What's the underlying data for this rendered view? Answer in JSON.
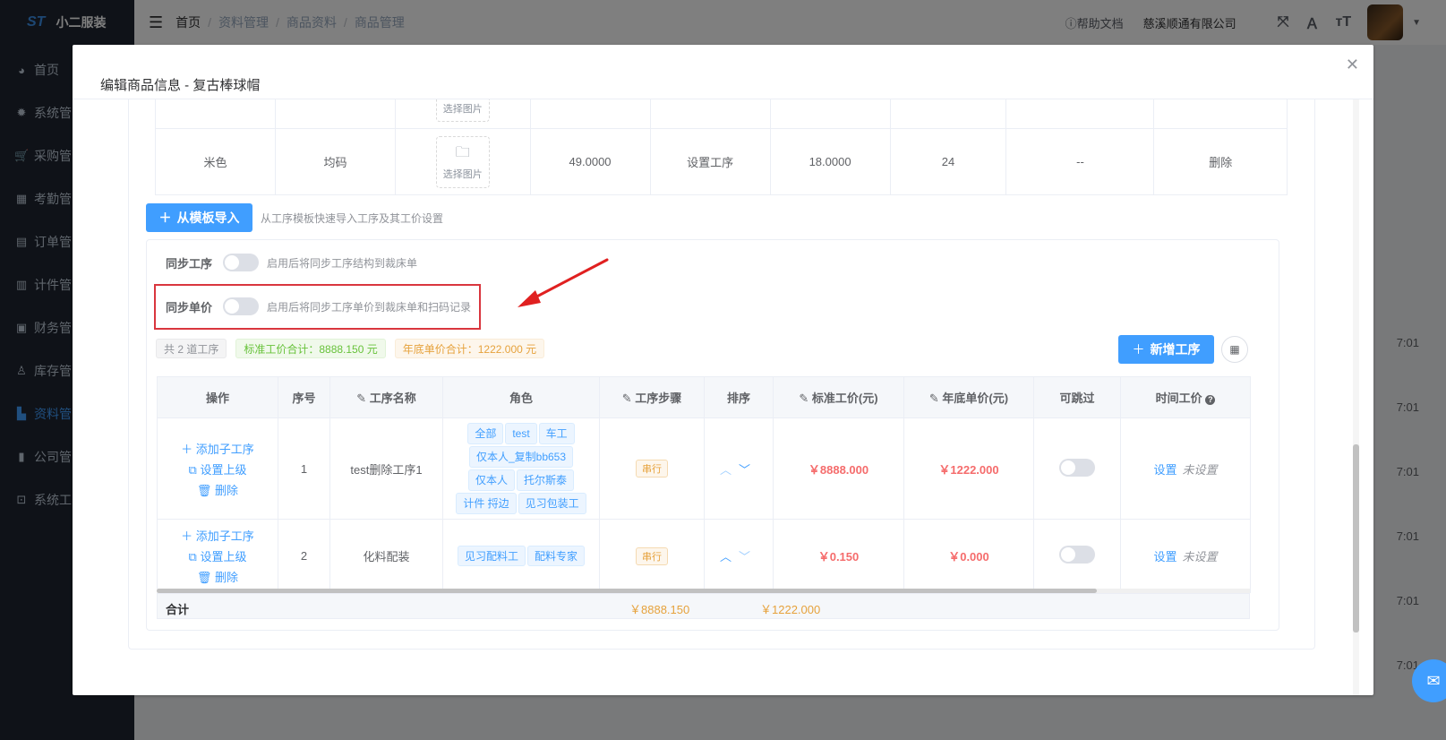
{
  "app": {
    "logo": "ST",
    "name": "小二服装"
  },
  "sidebar": {
    "items": [
      {
        "label": "首页",
        "icon": "dashboard-icon"
      },
      {
        "label": "系统管",
        "icon": "gear-icon"
      },
      {
        "label": "采购管",
        "icon": "cart-icon"
      },
      {
        "label": "考勤管",
        "icon": "grid-icon"
      },
      {
        "label": "订单管",
        "icon": "document-icon"
      },
      {
        "label": "计件管",
        "icon": "book-icon"
      },
      {
        "label": "财务管",
        "icon": "chart-icon"
      },
      {
        "label": "库存管",
        "icon": "user-icon"
      },
      {
        "label": "资料管",
        "icon": "file-icon"
      },
      {
        "label": "公司管",
        "icon": "bar-chart-icon"
      },
      {
        "label": "系统工",
        "icon": "toolbox-icon"
      }
    ]
  },
  "topbar": {
    "breadcrumb": [
      "首页",
      "资料管理",
      "商品资料",
      "商品管理"
    ],
    "help": "帮助文档",
    "company": "慈溪顺通有限公司"
  },
  "background": {
    "times": [
      "7:01",
      "7:01",
      "7:01",
      "7:01",
      "7:01",
      "7:01"
    ]
  },
  "dialog": {
    "title": "编辑商品信息 - 复古棒球帽",
    "sku_rows": [
      {
        "color": "",
        "size": "",
        "image": "选择图片",
        "price": "",
        "process": "",
        "cost": "",
        "qty": "",
        "extra": "",
        "action": ""
      },
      {
        "color": "米色",
        "size": "均码",
        "image": "选择图片",
        "price": "49.0000",
        "process": "设置工序",
        "cost": "18.0000",
        "qty": "24",
        "extra": "--",
        "action": "删除"
      }
    ],
    "import_button": "从模板导入",
    "import_tip": "从工序模板快速导入工序及其工价设置",
    "sync_process": {
      "label": "同步工序",
      "tip": "启用后将同步工序结构到裁床单"
    },
    "sync_price": {
      "label": "同步单价",
      "tip": "启用后将同步工序单价到裁床单和扫码记录"
    },
    "stats": {
      "count": "共 2 道工序",
      "standard_total": "标准工价合计：8888.150 元",
      "year_total": "年底单价合计：1222.000 元"
    },
    "add_button": "新增工序",
    "columns": [
      "操作",
      "序号",
      "工序名称",
      "角色",
      "工序步骤",
      "排序",
      "标准工价(元)",
      "年底单价(元)",
      "可跳过",
      "时间工价"
    ],
    "op_labels": {
      "add_child": "添加子工序",
      "set_parent": "设置上级",
      "delete": "删除"
    },
    "rows": [
      {
        "no": "1",
        "name": "test删除工序1",
        "roles": [
          "全部",
          "test",
          "车工",
          "仅本人_复制bb653",
          "仅本人",
          "托尔斯泰",
          "计件 捋边",
          "见习包装工"
        ],
        "step": "串行",
        "std": "￥8888.000",
        "year": "￥1222.000",
        "set": "设置",
        "unset": "未设置"
      },
      {
        "no": "2",
        "name": "化料配装",
        "roles": [
          "见习配料工",
          "配料专家"
        ],
        "step": "串行",
        "std": "￥0.150",
        "year": "￥0.000",
        "set": "设置",
        "unset": "未设置"
      }
    ],
    "summary": {
      "label": "合计",
      "std": "￥8888.150",
      "year": "￥1222.000"
    }
  }
}
